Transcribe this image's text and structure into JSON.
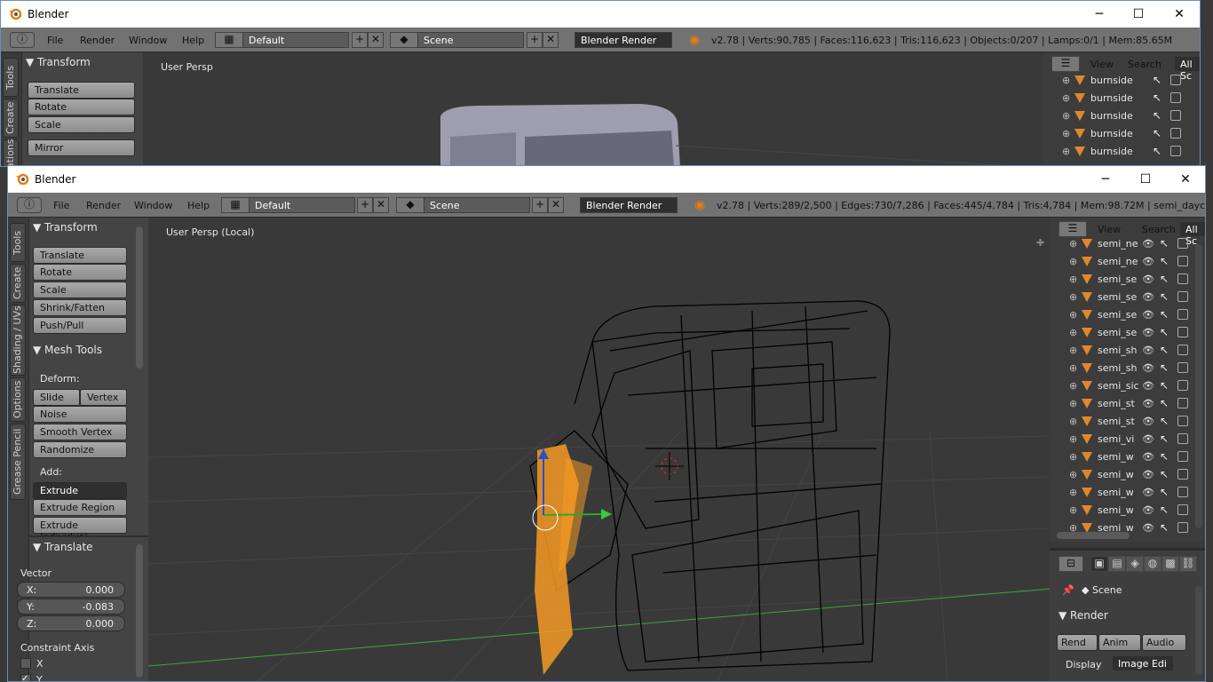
{
  "back": {
    "title": "Blender",
    "menus": [
      "File",
      "Render",
      "Window",
      "Help"
    ],
    "layout": "Default",
    "scene": "Scene",
    "engine": "Blender Render",
    "stats": "v2.78 | Verts:90,785 | Faces:116,623 | Tris:116,623 | Objects:0/207 | Lamps:0/1 | Mem:85.65M",
    "viewport_label": "User Persp",
    "tabs": [
      "Tools",
      "Create",
      "ations"
    ],
    "panel_title": "Transform",
    "tools": [
      "Translate",
      "Rotate",
      "Scale",
      "Mirror"
    ],
    "outliner_header": [
      "View",
      "Search",
      "All Sc"
    ],
    "outliner_rows": [
      "burnside",
      "burnside",
      "burnside",
      "burnside",
      "burnside"
    ]
  },
  "front": {
    "title": "Blender",
    "menus": [
      "File",
      "Render",
      "Window",
      "Help"
    ],
    "layout": "Default",
    "scene": "Scene",
    "engine": "Blender Render",
    "stats": "v2.78 | Verts:289/2,500 | Edges:730/7,286 | Faces:445/4,784 | Tris:4,784 | Mem:98.72M | semi_daycab",
    "viewport_label": "User Persp (Local)",
    "tabs": [
      "Tools",
      "Create",
      "Shading / UVs",
      "Options",
      "Grease Pencil"
    ],
    "transform_title": "Transform",
    "transform_tools": [
      "Translate",
      "Rotate",
      "Scale",
      "Shrink/Fatten",
      "Push/Pull"
    ],
    "meshtools_title": "Mesh Tools",
    "deform_label": "Deform:",
    "deform_pair": [
      "Slide Ed",
      "Vertex"
    ],
    "deform_tools": [
      "Noise",
      "Smooth Vertex",
      "Randomize"
    ],
    "add_label": "Add:",
    "extrude_select": "Extrude",
    "add_tools": [
      "Extrude Region",
      "Extrude Individual"
    ],
    "operator_title": "Translate",
    "vector_label": "Vector",
    "vector": {
      "x_label": "X:",
      "x": "0.000",
      "y_label": "Y:",
      "y": "-0.083",
      "z_label": "Z:",
      "z": "0.000"
    },
    "constraint_label": "Constraint Axis",
    "constraint_x": "X",
    "constraint_y": "Y",
    "outliner_header": [
      "View",
      "Search",
      "All Sc"
    ],
    "outliner_rows": [
      "semi_ne",
      "semi_ne",
      "semi_se",
      "semi_se",
      "semi_se",
      "semi_se",
      "semi_sh",
      "semi_sh",
      "semi_sic",
      "semi_st",
      "semi_st",
      "semi_vi",
      "semi_w",
      "semi_w",
      "semi_w",
      "semi_w",
      "semi_w"
    ],
    "props": {
      "scene_label": "Scene",
      "render_title": "Render",
      "buttons": [
        "Rend",
        "Anim",
        "Audio"
      ],
      "display_label": "Display",
      "display_value": "Image Edi"
    }
  },
  "colors": {
    "selection": "#f59a23",
    "wire": "#000000",
    "grid_green": "#3aa63a",
    "accent": "#e0872e"
  }
}
